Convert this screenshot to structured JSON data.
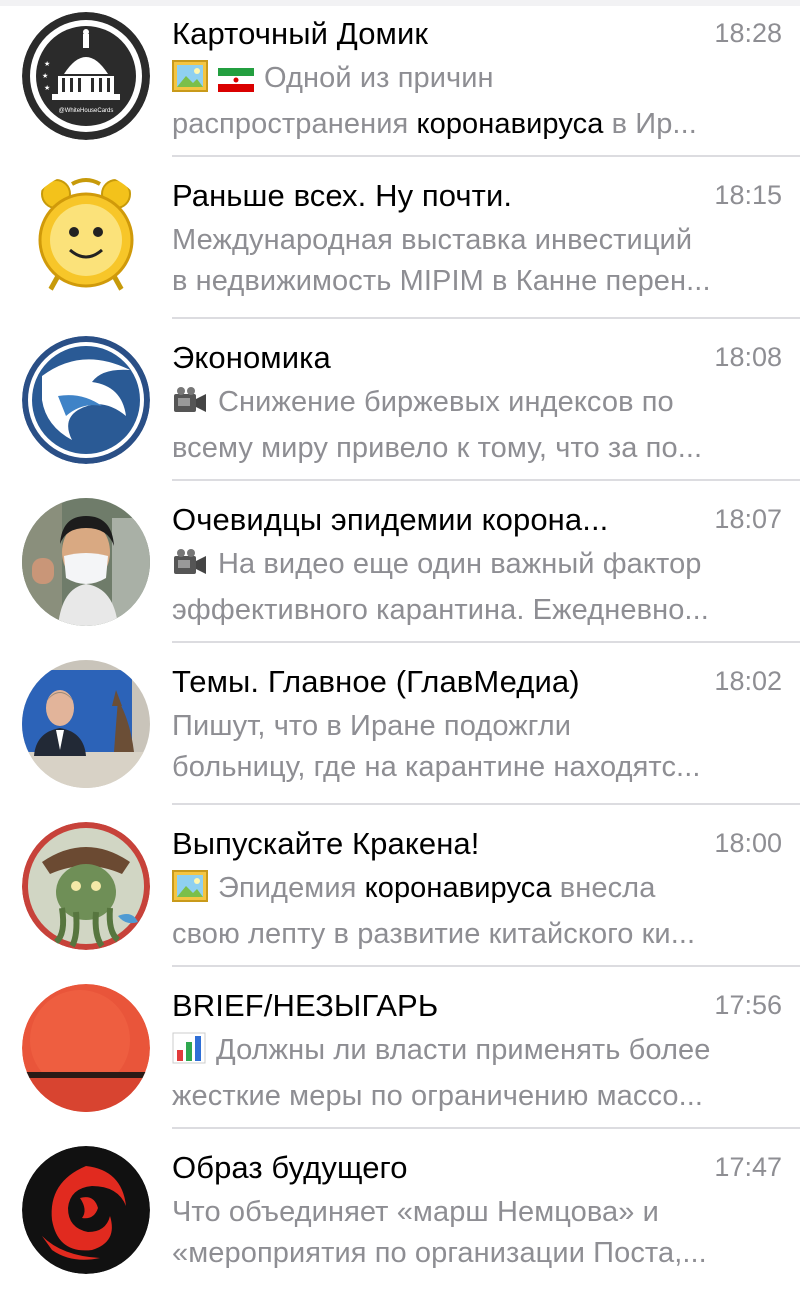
{
  "chats": [
    {
      "title": "Карточный Домик",
      "time": "18:28",
      "avatar_icon": "capitol-dome-logo-icon",
      "avatar_caption": "@WhiteHouseCards",
      "media_icons": [
        "photo-icon",
        "iran-flag-icon"
      ],
      "preview_line1": "Одной из причин",
      "preview_line2_a": "распространения ",
      "preview_line2_hl": "коронавируса",
      "preview_line2_b": " в Ир..."
    },
    {
      "title": "Раньше всех. Ну почти.",
      "time": "18:15",
      "avatar_icon": "alarm-clock-icon",
      "preview_line1": "Международная выставка инвестиций",
      "preview_line2": "в недвижимость MIPIM в Канне перен..."
    },
    {
      "title": "Экономика",
      "time": "18:08",
      "avatar_icon": "eagle-logo-icon",
      "media_icons": [
        "video-camera-icon"
      ],
      "preview_line1": "Снижение биржевых индексов по",
      "preview_line2": "всему миру привело к тому, что за по..."
    },
    {
      "title": "Очевидцы эпидемии корона...",
      "time": "18:07",
      "avatar_icon": "masked-person-photo-icon",
      "media_icons": [
        "video-camera-icon"
      ],
      "preview_line1": "На видео еще один важный фактор",
      "preview_line2": "эффективного карантина. Ежедневно..."
    },
    {
      "title": "Темы. Главное (ГлавМедиа)",
      "time": "18:02",
      "avatar_icon": "speaker-photo-icon",
      "preview_line1": "Пишут, что в Иране подожгли",
      "preview_line2": "больницу, где на карантине находятс..."
    },
    {
      "title": "Выпускайте Кракена!",
      "time": "18:00",
      "avatar_icon": "kraken-pirate-icon",
      "media_icons": [
        "photo-icon"
      ],
      "preview_line1_a": "Эпидемия ",
      "preview_line1_hl": "коронавируса",
      "preview_line1_b": " внесла",
      "preview_line2": "свою лепту в развитие китайского ки..."
    },
    {
      "title": "BRIEF/НЕЗЫГАРЬ",
      "time": "17:56",
      "avatar_icon": "red-circle-icon",
      "media_icons": [
        "bar-chart-icon"
      ],
      "preview_line1": "Должны ли власти применять более",
      "preview_line2": "жесткие меры по ограничению массо..."
    },
    {
      "title": "Образ будущего",
      "time": "17:47",
      "avatar_icon": "phoenix-swirl-icon",
      "preview_line1": "Что объединяет «марш Немцова» и",
      "preview_line2": "«мероприятия по организации Поста,..."
    }
  ]
}
